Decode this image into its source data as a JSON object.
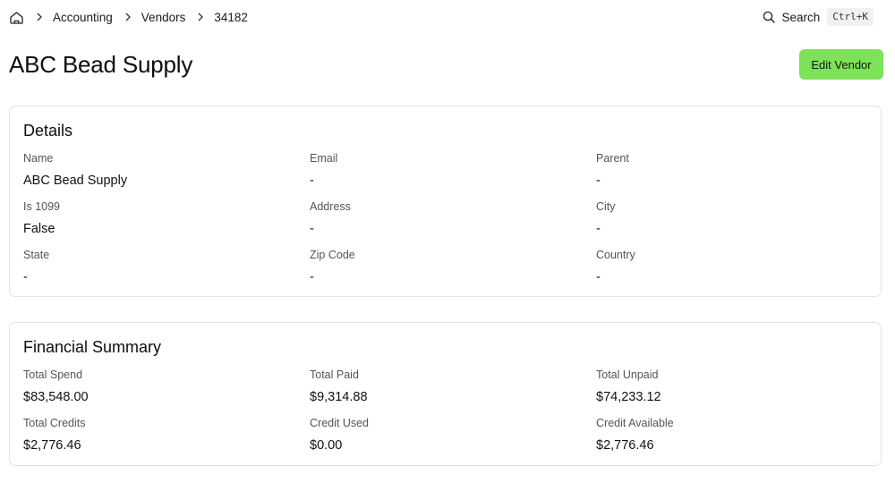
{
  "breadcrumb": {
    "items": [
      "Accounting",
      "Vendors"
    ],
    "current": "34182"
  },
  "search": {
    "label": "Search",
    "shortcut": "Ctrl+K"
  },
  "header": {
    "title": "ABC Bead Supply",
    "edit_label": "Edit Vendor"
  },
  "details": {
    "title": "Details",
    "fields": [
      {
        "label": "Name",
        "value": "ABC Bead Supply"
      },
      {
        "label": "Email",
        "value": "-"
      },
      {
        "label": "Parent",
        "value": "-"
      },
      {
        "label": "Is 1099",
        "value": "False"
      },
      {
        "label": "Address",
        "value": "-"
      },
      {
        "label": "City",
        "value": "-"
      },
      {
        "label": "State",
        "value": "-"
      },
      {
        "label": "Zip Code",
        "value": "-"
      },
      {
        "label": "Country",
        "value": "-"
      }
    ]
  },
  "financial": {
    "title": "Financial Summary",
    "fields": [
      {
        "label": "Total Spend",
        "value": "$83,548.00"
      },
      {
        "label": "Total Paid",
        "value": "$9,314.88"
      },
      {
        "label": "Total Unpaid",
        "value": "$74,233.12"
      },
      {
        "label": "Total Credits",
        "value": "$2,776.46"
      },
      {
        "label": "Credit Used",
        "value": "$0.00"
      },
      {
        "label": "Credit Available",
        "value": "$2,776.46"
      }
    ]
  },
  "icons": {
    "home": "home-icon",
    "separator": "chevron-right-icon",
    "search": "search-icon"
  },
  "colors": {
    "accent": "#7ee258",
    "border": "#e3e3e3"
  }
}
